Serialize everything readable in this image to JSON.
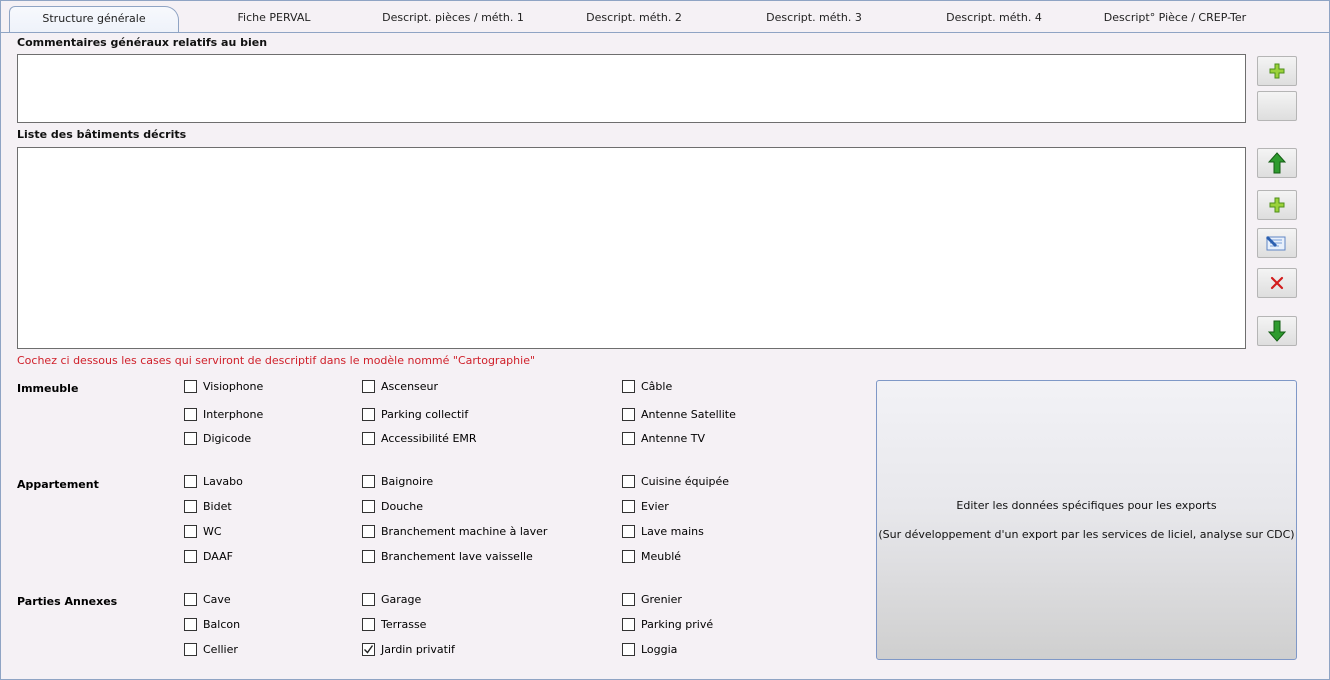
{
  "tabs": [
    {
      "label": "Structure générale",
      "active": true
    },
    {
      "label": "Fiche PERVAL"
    },
    {
      "label": "Descript. pièces / méth. 1"
    },
    {
      "label": "Descript. méth. 2"
    },
    {
      "label": "Descript. méth. 3"
    },
    {
      "label": "Descript. méth. 4"
    },
    {
      "label": "Descript° Pièce / CREP-Ter"
    }
  ],
  "comments": {
    "label": "Commentaires généraux relatifs au bien",
    "value": ""
  },
  "buildings": {
    "label": "Liste des bâtiments décrits"
  },
  "note": "Cochez ci dessous les cases qui serviront de descriptif dans le modèle nommé \"Cartographie\"",
  "groups": [
    {
      "label": "Immeuble",
      "items": [
        {
          "label": "Visiophone",
          "checked": false
        },
        {
          "label": "Ascenseur",
          "checked": false
        },
        {
          "label": "Câble",
          "checked": false
        },
        {
          "label": "Interphone",
          "checked": false
        },
        {
          "label": "Parking collectif",
          "checked": false
        },
        {
          "label": "Antenne Satellite",
          "checked": false
        },
        {
          "label": "Digicode",
          "checked": false
        },
        {
          "label": "Accessibilité EMR",
          "checked": false
        },
        {
          "label": "Antenne TV",
          "checked": false
        }
      ]
    },
    {
      "label": "Appartement",
      "items": [
        {
          "label": "Lavabo",
          "checked": false
        },
        {
          "label": "Baignoire",
          "checked": false
        },
        {
          "label": "Cuisine équipée",
          "checked": false
        },
        {
          "label": "Bidet",
          "checked": false
        },
        {
          "label": "Douche",
          "checked": false
        },
        {
          "label": "Evier",
          "checked": false
        },
        {
          "label": "WC",
          "checked": false
        },
        {
          "label": "Branchement machine à laver",
          "checked": false
        },
        {
          "label": "Lave mains",
          "checked": false
        },
        {
          "label": "DAAF",
          "checked": false
        },
        {
          "label": "Branchement lave vaisselle",
          "checked": false
        },
        {
          "label": "Meublé",
          "checked": false
        }
      ]
    },
    {
      "label": "Parties Annexes",
      "items": [
        {
          "label": "Cave",
          "checked": false
        },
        {
          "label": "Garage",
          "checked": false
        },
        {
          "label": "Grenier",
          "checked": false
        },
        {
          "label": "Balcon",
          "checked": false
        },
        {
          "label": "Terrasse",
          "checked": false
        },
        {
          "label": "Parking privé",
          "checked": false
        },
        {
          "label": "Cellier",
          "checked": false
        },
        {
          "label": "Jardin privatif",
          "checked": true
        },
        {
          "label": "Loggia",
          "checked": false
        }
      ]
    }
  ],
  "export_panel": {
    "line1": "Editer les données spécifiques pour les exports",
    "line2": "(Sur développement d'un export par les services de liciel, analyse sur CDC)"
  },
  "colors": {
    "note": "#d0202a",
    "border": "#8fa4c4",
    "icon_green": "#2e9b2e",
    "icon_red": "#d21c1c"
  },
  "icons": [
    "plus-icon",
    "arrow-up-icon",
    "plus-icon",
    "edit-icon",
    "delete-icon",
    "arrow-down-icon"
  ]
}
